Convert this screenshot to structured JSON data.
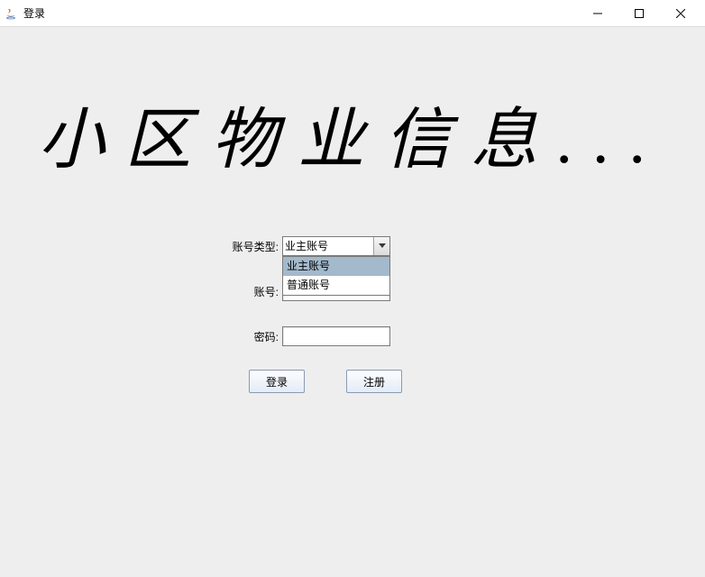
{
  "window": {
    "title": "登录"
  },
  "heading": "小区物业信息...",
  "form": {
    "type_label": "账号类型:",
    "account_label": "账号:",
    "password_label": "密码:",
    "account_value": "",
    "password_value": ""
  },
  "combo": {
    "selected": "业主账号",
    "options": [
      "业主账号",
      "普通账号"
    ]
  },
  "buttons": {
    "login": "登录",
    "register": "注册"
  }
}
